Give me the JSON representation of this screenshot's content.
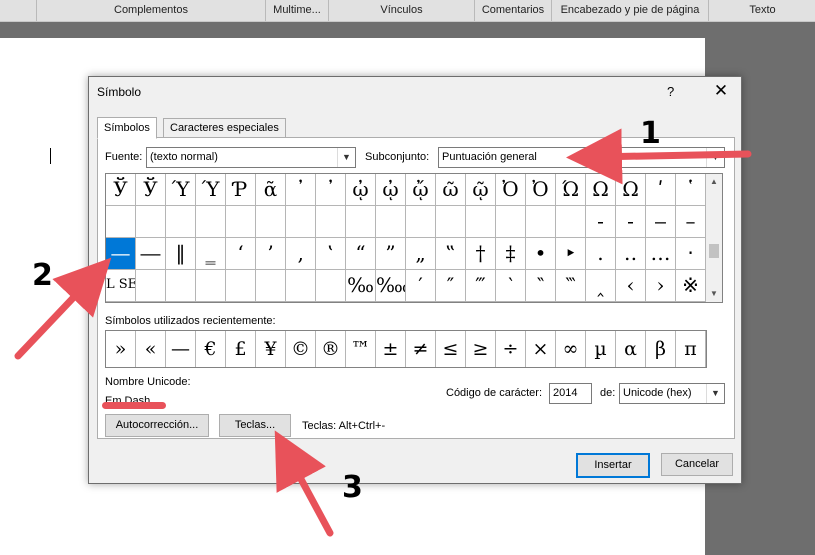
{
  "ribbon": {
    "groups": [
      "Complementos",
      "Multime...",
      "Vínculos",
      "Comentarios",
      "Encabezado y pie de página",
      "Texto"
    ]
  },
  "dialog": {
    "title": "Símbolo",
    "help_label": "?",
    "close_label": "✕",
    "tabs": [
      "Símbolos",
      "Caracteres especiales"
    ],
    "font_label": "Fuente:",
    "font_value": "(texto normal)",
    "subset_label": "Subconjunto:",
    "subset_value": "Puntuación general",
    "symbol_grid": [
      [
        "Ў",
        "Ў",
        "Ύ",
        "Ύ",
        "Ƥ",
        "ᾶ",
        "᾿",
        "᾽",
        "ᾠ",
        "ᾠ",
        "ᾤ",
        "ῶ",
        "ῷ",
        "Ὀ",
        "Ὀ",
        "Ώ",
        "Ω",
        "Ω",
        "ʹ",
        "῾"
      ],
      [
        "",
        "",
        "",
        "",
        "",
        "",
        "",
        "",
        "",
        "",
        "",
        "",
        "",
        "",
        "",
        "",
        "‐",
        "‑",
        "‒",
        "–"
      ],
      [
        "—",
        "―",
        "‖",
        "‗",
        "‘",
        "’",
        "‚",
        "‛",
        "“",
        "”",
        "„",
        "‟",
        "†",
        "‡",
        "•",
        "‣",
        "․",
        "‥",
        "…",
        "‧"
      ],
      [
        "L SEP",
        "",
        "",
        "",
        "",
        "",
        "",
        "",
        "‰",
        "‱",
        "′",
        "″",
        "‴",
        "‵",
        "‶",
        "‷",
        "‸",
        "‹",
        "›",
        "※"
      ]
    ],
    "recent_label": "Símbolos utilizados recientemente:",
    "recent_symbols": [
      "»",
      "«",
      "—",
      "€",
      "£",
      "¥",
      "©",
      "®",
      "™",
      "±",
      "≠",
      "≤",
      "≥",
      "÷",
      "×",
      "∞",
      "µ",
      "α",
      "β",
      "π"
    ],
    "unicode_name_label": "Nombre Unicode:",
    "unicode_name_value": "Em Dash",
    "char_code_label": "Código de carácter:",
    "char_code_value": "2014",
    "from_label": "de:",
    "from_value": "Unicode (hex)",
    "autocorrect_label": "Autocorrección...",
    "keys_label": "Teclas...",
    "shortcut_text": "Teclas: Alt+Ctrl+-",
    "insert_label": "Insertar",
    "cancel_label": "Cancelar"
  },
  "annotations": {
    "step1": "1",
    "step2": "2",
    "step3": "3",
    "color": "#e8525a"
  },
  "colors": {
    "selection": "#0078d7",
    "dialog_bg": "#f0f0f0",
    "ribbon_bg": "#e1e1e1"
  }
}
